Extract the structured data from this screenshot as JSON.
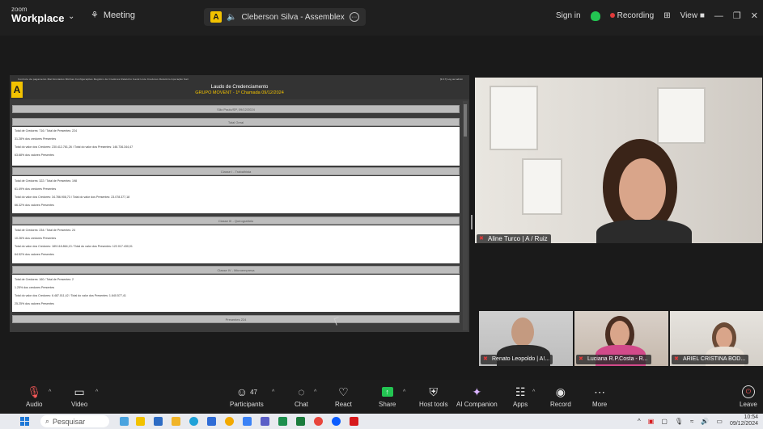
{
  "topbar": {
    "brand_small": "zoom",
    "brand_large": "Workplace",
    "meeting_label": "Meeting",
    "share_label": "Cleberson Silva - Assemblex",
    "sign_in": "Sign in",
    "recording": "Recording",
    "view": "View"
  },
  "share": {
    "doc_title": "Laudo de Credenciamento",
    "doc_subtitle": "GRUPO MOVENT - 1ª Chamada 09/12/2024",
    "location": "São Paulo/SP, 09/12/2024",
    "nav_text": "Controle de pagamento   Mail Enviados   Minhas Configurações   Registro de Credores   Relatório Geral   Liste Credores   Relatório Apuração   Sair",
    "user_text": "[3.0.7]  Log out admin",
    "sections": [
      {
        "title": "Total Geral",
        "lines": [
          "Total de Credores: 716 / Total de Presentes: 224",
          "31.28% dos credores Presentes",
          "Total do valor dos Credores: 230.412.781,26 / Total do valor dos Presentes: 146.736.344,47",
          "63.68% dos valores Presentes"
        ]
      },
      {
        "title": "Classe I - Trabalhista",
        "lines": [
          "Total de Credores: 322 / Total de Presentes: 198",
          "61.49% dos credores Presentes",
          "Total do valor dos Credores: 34.786.908,73 / Total do valor dos Presentes: 23.078.377,18",
          "66.32% dos valores Presentes"
        ]
      },
      {
        "title": "Classe III - Quirografário",
        "lines": [
          "Total de Credores: 234 / Total de Presentes: 24",
          "10.26% dos credores Presentes",
          "Total do valor dos Credores: 189.118.864,13 / Total do valor dos Presentes: 122.017.430,01",
          "64.52% dos valores Presentes"
        ]
      },
      {
        "title": "Classe IV - Microempresa",
        "lines": [
          "Total de Credores: 160 / Total de Presentes: 2",
          "1.25% dos credores Presentes",
          "Total do valor dos Credores: 6.487.011,42 / Total do valor dos Presentes: 1.640.577,41",
          "25.25% dos valores Presentes"
        ]
      }
    ],
    "footer_bar": "Presentes 224"
  },
  "participants": {
    "main": "Aline Turco | A / Ruiz",
    "thumbs": [
      "Renato Leopoldo | A!...",
      "Luciana R.P.Costa - R...",
      "ARIEL CRISTINA BOD..."
    ]
  },
  "toolbar": {
    "audio": "Audio",
    "video": "Video",
    "participants": "Participants",
    "participants_count": "47",
    "chat": "Chat",
    "react": "React",
    "share": "Share",
    "host_tools": "Host tools",
    "ai_companion": "AI Companion",
    "apps": "Apps",
    "record": "Record",
    "more": "More",
    "leave": "Leave"
  },
  "taskbar": {
    "search_placeholder": "Pesquisar",
    "time": "10:54",
    "date": "09/12/2024"
  },
  "colors": {
    "accent_yellow": "#f2c200",
    "share_green": "#23c552",
    "recording_red": "#e03a3a",
    "background": "#1a1a1a"
  }
}
